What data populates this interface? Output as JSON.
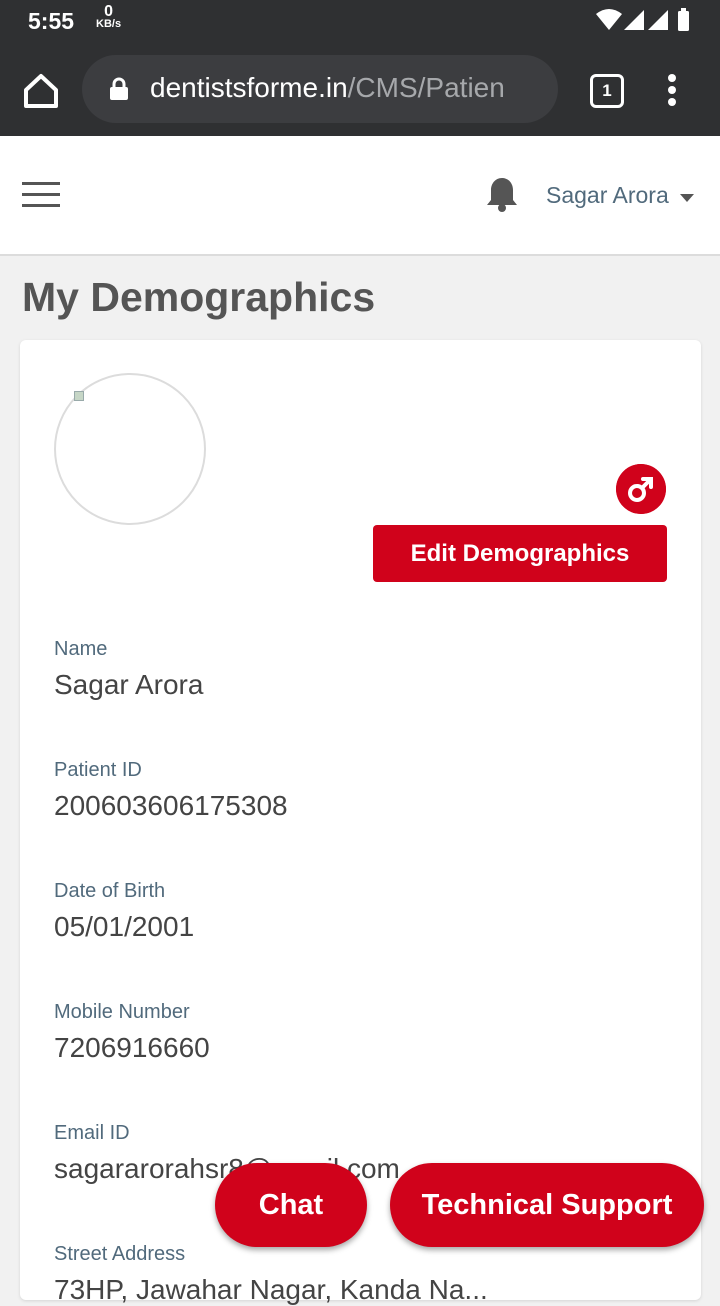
{
  "status_bar": {
    "time": "5:55",
    "net_speed_value": "0",
    "net_speed_unit": "KB/s"
  },
  "browser": {
    "url_domain": "dentistsforme.in",
    "url_path": "/CMS/Patien",
    "tab_count": "1"
  },
  "header": {
    "user_name": "Sagar Arora"
  },
  "page": {
    "title": "My Demographics"
  },
  "profile": {
    "edit_button_label": "Edit Demographics",
    "fields": [
      {
        "label": "Name",
        "value": "Sagar Arora"
      },
      {
        "label": "Patient ID",
        "value": "200603606175308"
      },
      {
        "label": "Date of Birth",
        "value": "05/01/2001"
      },
      {
        "label": "Mobile Number",
        "value": "7206916660"
      },
      {
        "label": "Email ID",
        "value": "sagararorahsr8@gmail.com"
      },
      {
        "label": "Street Address",
        "value": "73HP, Jawahar Nagar, Kanda Na..."
      }
    ]
  },
  "fabs": {
    "chat_label": "Chat",
    "support_label": "Technical Support"
  },
  "colors": {
    "brand_red": "#d0021b",
    "label_slate": "#516a7c",
    "browser_dark": "#2f3032"
  },
  "icons": [
    "home-icon",
    "lock-icon",
    "tabs-icon",
    "more-vert-icon",
    "hamburger-icon",
    "bell-icon",
    "caret-down-icon",
    "male-icon",
    "wifi-icon",
    "signal-icon",
    "battery-icon"
  ]
}
